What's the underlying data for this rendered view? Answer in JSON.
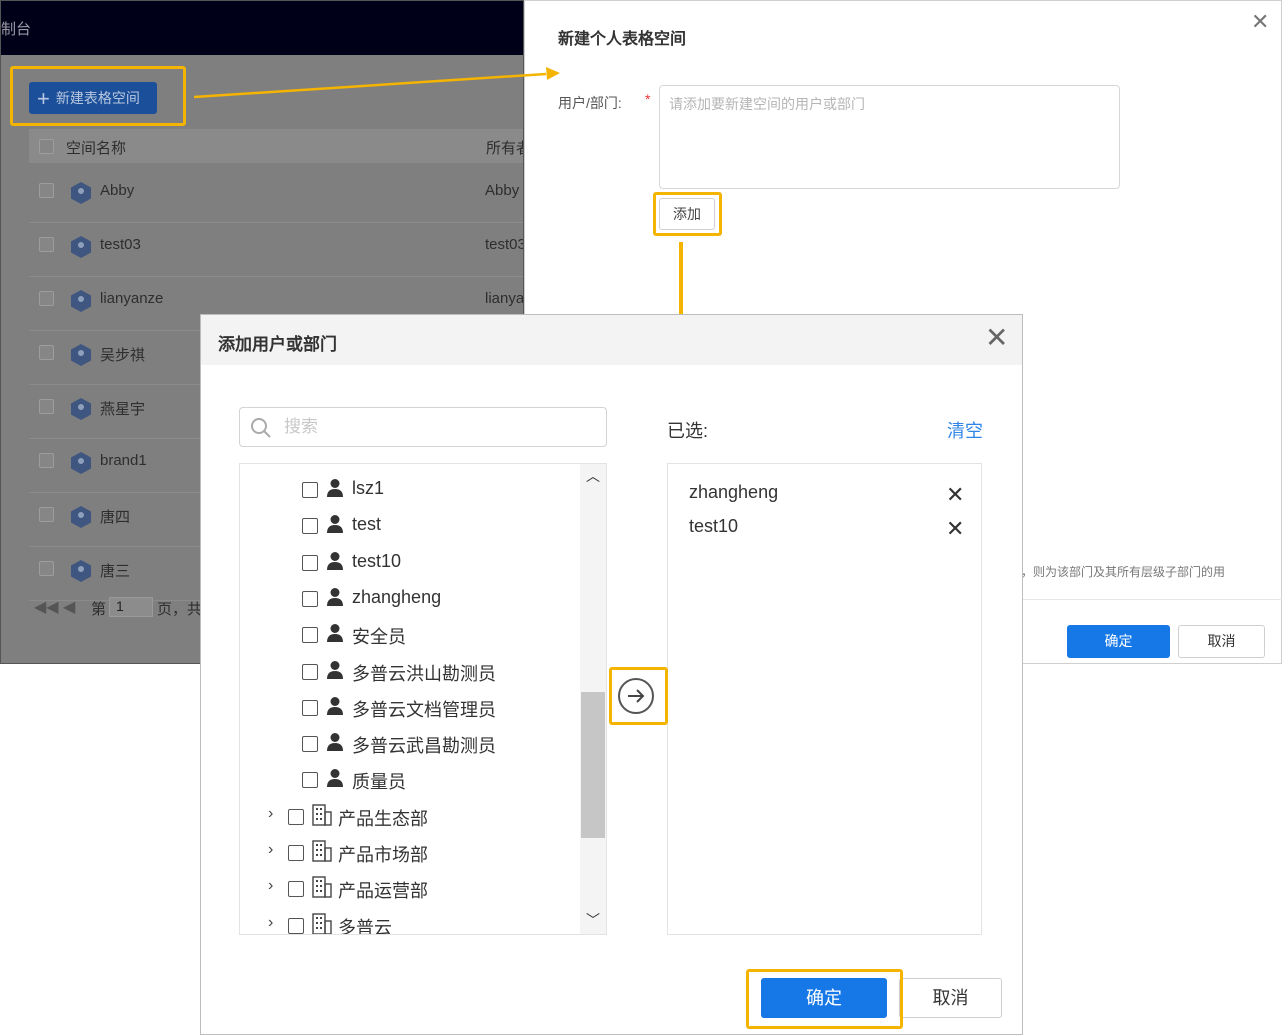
{
  "background_page": {
    "header_fragment": "制台",
    "new_space_button": "新建表格空间",
    "columns": {
      "name": "空间名称",
      "owner": "所有者"
    },
    "rows": [
      {
        "name": "Abby",
        "owner": "Abby"
      },
      {
        "name": "test03",
        "owner": "test03"
      },
      {
        "name": "lianyanze",
        "owner": "lianya"
      },
      {
        "name": "吴步祺",
        "owner": ""
      },
      {
        "name": "燕星宇",
        "owner": ""
      },
      {
        "name": "brand1",
        "owner": ""
      },
      {
        "name": "唐四",
        "owner": ""
      },
      {
        "name": "唐三",
        "owner": ""
      }
    ],
    "pager": {
      "prefix": "第",
      "page": "1",
      "suffix": "页，共"
    }
  },
  "create_panel": {
    "title": "新建个人表格空间",
    "field_label": "用户/部门:",
    "required_mark": "*",
    "placeholder": "请添加要新建空间的用户或部门",
    "add_button": "添加",
    "note": "，则为该部门及其所有层级子部门的用",
    "ok_button": "确定",
    "cancel_button": "取消"
  },
  "dialog": {
    "title": "添加用户或部门",
    "search_placeholder": "搜索",
    "tree": [
      {
        "type": "user",
        "label": "lsz1"
      },
      {
        "type": "user",
        "label": "test"
      },
      {
        "type": "user",
        "label": "test10"
      },
      {
        "type": "user",
        "label": "zhangheng"
      },
      {
        "type": "user",
        "label": "安全员"
      },
      {
        "type": "user",
        "label": "多普云洪山勘测员"
      },
      {
        "type": "user",
        "label": "多普云文档管理员"
      },
      {
        "type": "user",
        "label": "多普云武昌勘测员"
      },
      {
        "type": "user",
        "label": "质量员"
      },
      {
        "type": "dept",
        "label": "产品生态部"
      },
      {
        "type": "dept",
        "label": "产品市场部"
      },
      {
        "type": "dept",
        "label": "产品运营部"
      },
      {
        "type": "dept",
        "label": "多普云"
      }
    ],
    "selected_label": "已选:",
    "clear": "清空",
    "selected": [
      "zhangheng",
      "test10"
    ],
    "ok_button": "确定",
    "cancel_button": "取消"
  },
  "colors": {
    "primary": "#1677e6",
    "highlight": "#f5b400",
    "link": "#2f86e8"
  }
}
